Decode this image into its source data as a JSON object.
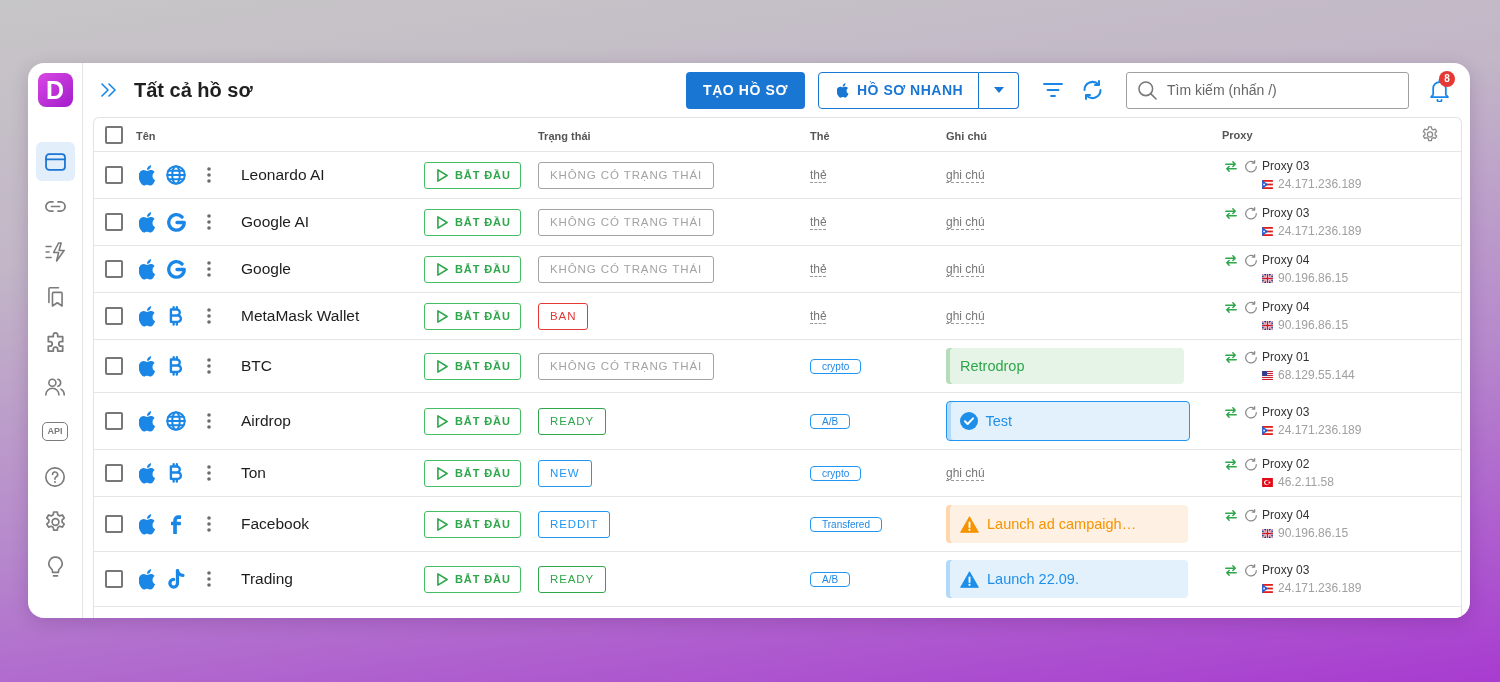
{
  "app": {
    "logo": "D"
  },
  "sidebar": {
    "items": [
      {
        "kind": "profiles",
        "selected": true
      },
      {
        "kind": "link",
        "selected": false
      },
      {
        "kind": "automation",
        "selected": false
      },
      {
        "kind": "bookmarks",
        "selected": false
      },
      {
        "kind": "extensions",
        "selected": false
      },
      {
        "kind": "team",
        "selected": false
      },
      {
        "kind": "api",
        "text": "API",
        "selected": false
      },
      {
        "kind": "help",
        "selected": false
      },
      {
        "kind": "settings",
        "selected": false
      },
      {
        "kind": "tips",
        "selected": false
      }
    ]
  },
  "header": {
    "title": "Tất cả hồ sơ",
    "create_button": "TẠO HỒ SƠ",
    "quick_button": "HỒ SƠ NHANH",
    "search": {
      "placeholder": "Tìm kiếm (nhấn /)"
    },
    "notifications": {
      "count": "8"
    }
  },
  "table": {
    "select_all": {
      "checked": false
    },
    "columns": [
      "Tên",
      "Trạng thái",
      "Thẻ",
      "Ghi chú",
      "Proxy"
    ],
    "rows": [
      {
        "checked": false,
        "site": {
          "kind": "globe"
        },
        "name": "Leonardo AI",
        "start": "BẮT ĐẦU",
        "status": {
          "text": "KHÔNG CÓ TRẠNG THÁI",
          "color": "#a3a3a3"
        },
        "tag": {
          "kind": "placeholder",
          "text": "thẻ"
        },
        "note": {
          "kind": "placeholder",
          "text": "ghi chú",
          "focused": false
        },
        "proxy": {
          "name": "Proxy 03",
          "flag": {
            "kind": "pr"
          },
          "ip": "24.171.236.189"
        }
      },
      {
        "checked": false,
        "site": {
          "kind": "google"
        },
        "name": "Google AI",
        "start": "BẮT ĐẦU",
        "status": {
          "text": "KHÔNG CÓ TRẠNG THÁI",
          "color": "#a3a3a3"
        },
        "tag": {
          "kind": "placeholder",
          "text": "thẻ"
        },
        "note": {
          "kind": "placeholder",
          "text": "ghi chú",
          "focused": false
        },
        "proxy": {
          "name": "Proxy 03",
          "flag": {
            "kind": "pr"
          },
          "ip": "24.171.236.189"
        }
      },
      {
        "checked": false,
        "site": {
          "kind": "google"
        },
        "name": "Google",
        "start": "BẮT ĐẦU",
        "status": {
          "text": "KHÔNG CÓ TRẠNG THÁI",
          "color": "#a3a3a3"
        },
        "tag": {
          "kind": "placeholder",
          "text": "thẻ"
        },
        "note": {
          "kind": "placeholder",
          "text": "ghi chú",
          "focused": false
        },
        "proxy": {
          "name": "Proxy 04",
          "flag": {
            "kind": "gb"
          },
          "ip": "90.196.86.15"
        }
      },
      {
        "checked": false,
        "site": {
          "kind": "bitcoin"
        },
        "name": "MetaMask Wallet",
        "start": "BẮT ĐẦU",
        "status": {
          "text": "BAN",
          "color": "#e53935"
        },
        "tag": {
          "kind": "placeholder",
          "text": "thẻ"
        },
        "note": {
          "kind": "placeholder",
          "text": "ghi chú",
          "focused": false
        },
        "proxy": {
          "name": "Proxy 04",
          "flag": {
            "kind": "gb"
          },
          "ip": "90.196.86.15"
        }
      },
      {
        "checked": false,
        "site": {
          "kind": "bitcoin"
        },
        "name": "BTC",
        "start": "BẮT ĐẦU",
        "status": {
          "text": "KHÔNG CÓ TRẠNG THÁI",
          "color": "#a3a3a3"
        },
        "tag": {
          "kind": "chip",
          "text": "crypto"
        },
        "note": {
          "kind": "success",
          "text": "Retrodrop",
          "focused": false
        },
        "proxy": {
          "name": "Proxy 01",
          "flag": {
            "kind": "us"
          },
          "ip": "68.129.55.144"
        }
      },
      {
        "checked": false,
        "site": {
          "kind": "globe"
        },
        "name": "Airdrop",
        "start": "BẮT ĐẦU",
        "status": {
          "text": "READY",
          "color": "#2ea64b"
        },
        "tag": {
          "kind": "chip",
          "text": "A/B"
        },
        "note": {
          "kind": "done",
          "text": "Test",
          "focused": true
        },
        "proxy": {
          "name": "Proxy 03",
          "flag": {
            "kind": "pr"
          },
          "ip": "24.171.236.189"
        }
      },
      {
        "checked": false,
        "site": {
          "kind": "bitcoin"
        },
        "name": "Ton",
        "start": "BẮT ĐẦU",
        "status": {
          "text": "NEW",
          "color": "#2196f3"
        },
        "tag": {
          "kind": "chip",
          "text": "crypto"
        },
        "note": {
          "kind": "placeholder",
          "text": "ghi chú",
          "focused": false
        },
        "proxy": {
          "name": "Proxy 02",
          "flag": {
            "kind": "tr"
          },
          "ip": "46.2.11.58"
        }
      },
      {
        "checked": false,
        "site": {
          "kind": "facebook"
        },
        "name": "Facebook",
        "start": "BẮT ĐẦU",
        "status": {
          "text": "REDDIT",
          "color": "#2196f3"
        },
        "tag": {
          "kind": "chip",
          "text": "Transfered"
        },
        "note": {
          "kind": "warning",
          "text": "Launch ad campaigh…",
          "focused": false
        },
        "proxy": {
          "name": "Proxy 04",
          "flag": {
            "kind": "gb"
          },
          "ip": "90.196.86.15"
        }
      },
      {
        "checked": false,
        "site": {
          "kind": "tiktok"
        },
        "name": "Trading",
        "start": "BẮT ĐẦU",
        "status": {
          "text": "READY",
          "color": "#2ea64b"
        },
        "tag": {
          "kind": "chip",
          "text": "A/B"
        },
        "note": {
          "kind": "alert",
          "text": "Launch 22.09.",
          "focused": false
        },
        "proxy": {
          "name": "Proxy 03",
          "flag": {
            "kind": "pr"
          },
          "ip": "24.171.236.189"
        }
      }
    ]
  }
}
